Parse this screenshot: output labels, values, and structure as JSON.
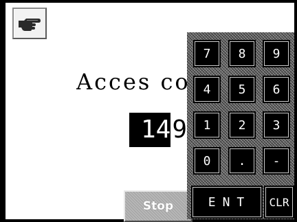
{
  "title": "Acces co",
  "code": {
    "value": "14",
    "caret_char": "9"
  },
  "keypad": {
    "keys": [
      {
        "name": "key-7",
        "label": "7"
      },
      {
        "name": "key-8",
        "label": "8"
      },
      {
        "name": "key-9",
        "label": "9"
      },
      {
        "name": "key-4",
        "label": "4"
      },
      {
        "name": "key-5",
        "label": "5"
      },
      {
        "name": "key-6",
        "label": "6"
      },
      {
        "name": "key-1",
        "label": "1"
      },
      {
        "name": "key-2",
        "label": "2"
      },
      {
        "name": "key-3",
        "label": "3"
      },
      {
        "name": "key-0",
        "label": "0"
      },
      {
        "name": "key-dot",
        "label": "."
      },
      {
        "name": "key-minus",
        "label": "-"
      },
      {
        "name": "enter-button",
        "label": "ENT"
      },
      {
        "name": "clear-button",
        "label": "CLR"
      }
    ]
  },
  "stop_label": "Stop",
  "icons": {
    "back": "pointing-hand-icon"
  },
  "colors": {
    "background": "#ffffff",
    "keys": "#000000",
    "key_text": "#ffffff",
    "stop_button": "#a8a8a8"
  }
}
